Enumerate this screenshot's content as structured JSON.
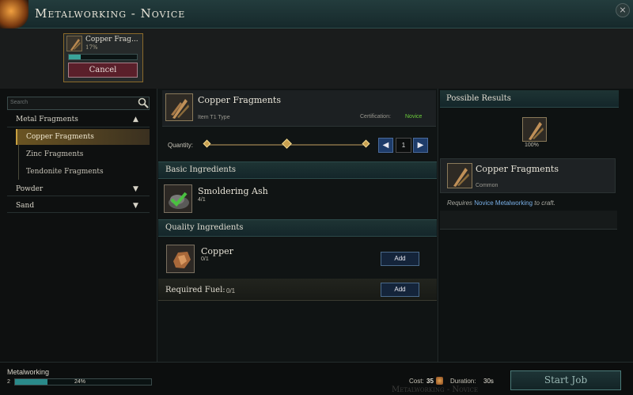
{
  "window": {
    "title": "Metalworking - Novice",
    "close_glyph": "×"
  },
  "active_job": {
    "name": "Copper Frag...",
    "progress_label": "17%",
    "progress": 0.17,
    "cancel_label": "Cancel"
  },
  "sidebar": {
    "search_placeholder": "Search",
    "categories": [
      {
        "label": "Metal Fragments",
        "arrow": "▲"
      },
      {
        "label": "Powder",
        "arrow": "▼"
      },
      {
        "label": "Sand",
        "arrow": "▼"
      }
    ],
    "subitems": [
      {
        "label": "Copper Fragments"
      },
      {
        "label": "Zinc Fragments"
      },
      {
        "label": "Tendonite Fragments"
      }
    ]
  },
  "recipe": {
    "name": "Copper Fragments",
    "type": "Item T1 Type",
    "certification_label": "Certification:",
    "certification_value": "Novice",
    "quantity_label": "Quantity:",
    "quantity_value": "1",
    "prev_glyph": "◀",
    "next_glyph": "▶"
  },
  "basic_ingredients": {
    "title": "Basic Ingredients",
    "items": [
      {
        "name": "Smoldering Ash",
        "count": "4/1"
      }
    ]
  },
  "quality_ingredients": {
    "title": "Quality Ingredients",
    "items": [
      {
        "name": "Copper",
        "count": "0/1",
        "add_label": "Add"
      }
    ]
  },
  "fuel": {
    "label": "Required Fuel:",
    "count": "0/1",
    "add_label": "Add"
  },
  "results": {
    "title": "Possible Results",
    "chance": "100%",
    "item_name": "Copper Fragments",
    "rarity": "Common",
    "requires_prefix": "Requires",
    "requires_skill": "Novice Metalworking",
    "requires_suffix": "to craft."
  },
  "footer": {
    "skill_name": "Metalworking",
    "skill_level": "2",
    "skill_pct_label": "24%",
    "skill_progress": 0.24,
    "ghost_title": "Metalworking - Novice",
    "cost_label": "Cost:",
    "cost_value": "35",
    "duration_label": "Duration:",
    "duration_value": "30s",
    "start_label": "Start Job"
  },
  "colors": {
    "accent_teal": "#3aa49a",
    "certification_green": "#6ccc3c",
    "skill_blue": "#7ab0e8",
    "gold": "#c8a040"
  }
}
